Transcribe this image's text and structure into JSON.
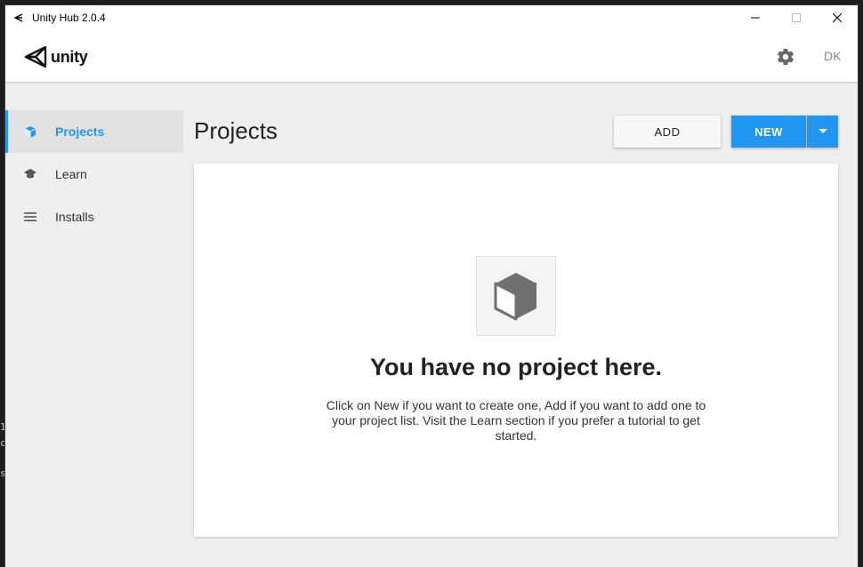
{
  "window": {
    "title": "Unity Hub 2.0.4",
    "controls": {
      "minimize_icon": "minimize-icon",
      "maximize_icon": "maximize-icon",
      "close_icon": "close-icon"
    }
  },
  "header": {
    "logo_text": "unity",
    "settings_icon": "gear-icon",
    "user_initials": "DK"
  },
  "sidebar": {
    "items": [
      {
        "label": "Projects",
        "icon": "cube-icon",
        "active": true
      },
      {
        "label": "Learn",
        "icon": "graduation-cap-icon",
        "active": false
      },
      {
        "label": "Installs",
        "icon": "list-icon",
        "active": false
      }
    ]
  },
  "main": {
    "title": "Projects",
    "add_label": "ADD",
    "new_label": "NEW",
    "empty_state": {
      "title": "You have no project here.",
      "description": "Click on New if you want to create one, Add if you want to add one to your project list. Visit the Learn section if you prefer a tutorial to get started."
    }
  },
  "colors": {
    "accent": "#2196f3",
    "sidebar_active_bg": "#e2e2e2",
    "window_bg": "#efefef"
  }
}
